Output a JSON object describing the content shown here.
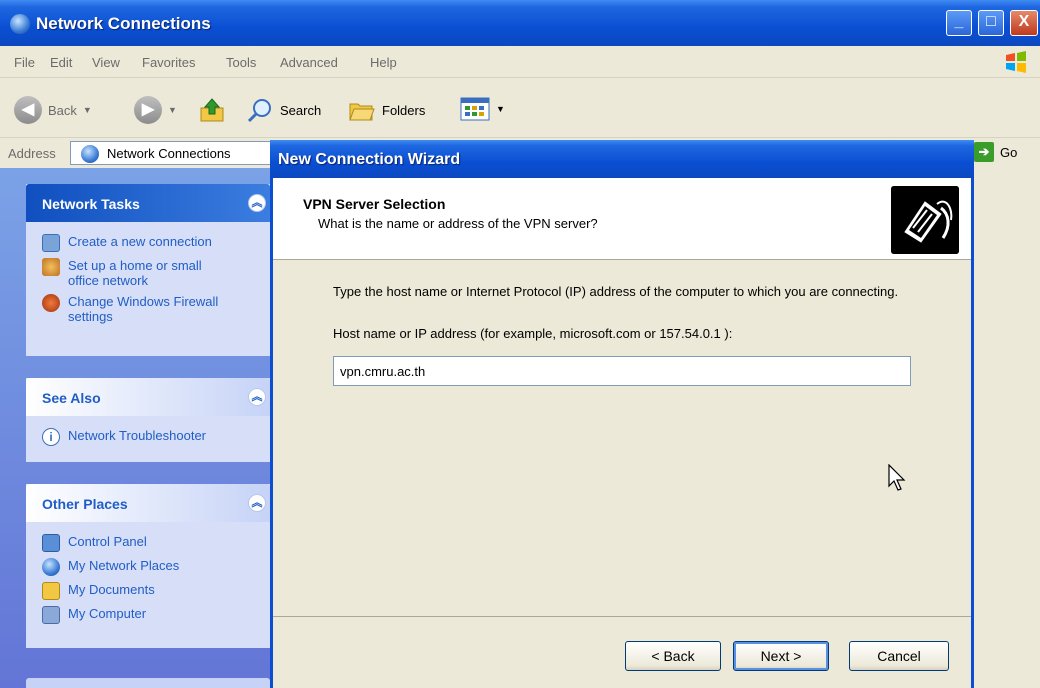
{
  "window": {
    "title": "Network Connections",
    "controls": {
      "minimize": "_",
      "maximize": "□",
      "close": "X"
    }
  },
  "menubar": {
    "items": [
      "File",
      "Edit",
      "View",
      "Favorites",
      "Tools",
      "Advanced",
      "Help"
    ]
  },
  "toolbar": {
    "back_label": "Back",
    "search_label": "Search",
    "folders_label": "Folders"
  },
  "address": {
    "label": "Address",
    "value": "Network Connections",
    "go_label": "Go"
  },
  "left_pane": {
    "network_tasks": {
      "title": "Network Tasks",
      "items": [
        {
          "label": "Create a new connection",
          "icon": "new-connection-icon"
        },
        {
          "label": "Set up a home or small office network",
          "icon": "home-network-icon"
        },
        {
          "label": "Change Windows Firewall settings",
          "icon": "firewall-icon"
        }
      ]
    },
    "see_also": {
      "title": "See Also",
      "items": [
        {
          "label": "Network Troubleshooter",
          "icon": "info-icon"
        }
      ]
    },
    "other_places": {
      "title": "Other Places",
      "items": [
        {
          "label": "Control Panel",
          "icon": "control-panel-icon"
        },
        {
          "label": "My Network Places",
          "icon": "network-places-icon"
        },
        {
          "label": "My Documents",
          "icon": "documents-icon"
        },
        {
          "label": "My Computer",
          "icon": "computer-icon"
        }
      ]
    }
  },
  "dialog": {
    "title": "New Connection Wizard",
    "header_title": "VPN Server Selection",
    "header_subtitle": "What is the name or address of the VPN server?",
    "body_text": "Type the host name or Internet Protocol (IP) address of the computer to which you are connecting.",
    "field_label": "Host name or IP address (for example, microsoft.com or 157.54.0.1 ):",
    "host_value": "vpn.cmru.ac.th",
    "buttons": {
      "back": "< Back",
      "next": "Next >",
      "cancel": "Cancel"
    }
  },
  "colors": {
    "title_blue": "#0a4fd3",
    "task_link": "#215dc6",
    "left_pane": "#6f8ee0",
    "chrome": "#ece9d8"
  }
}
